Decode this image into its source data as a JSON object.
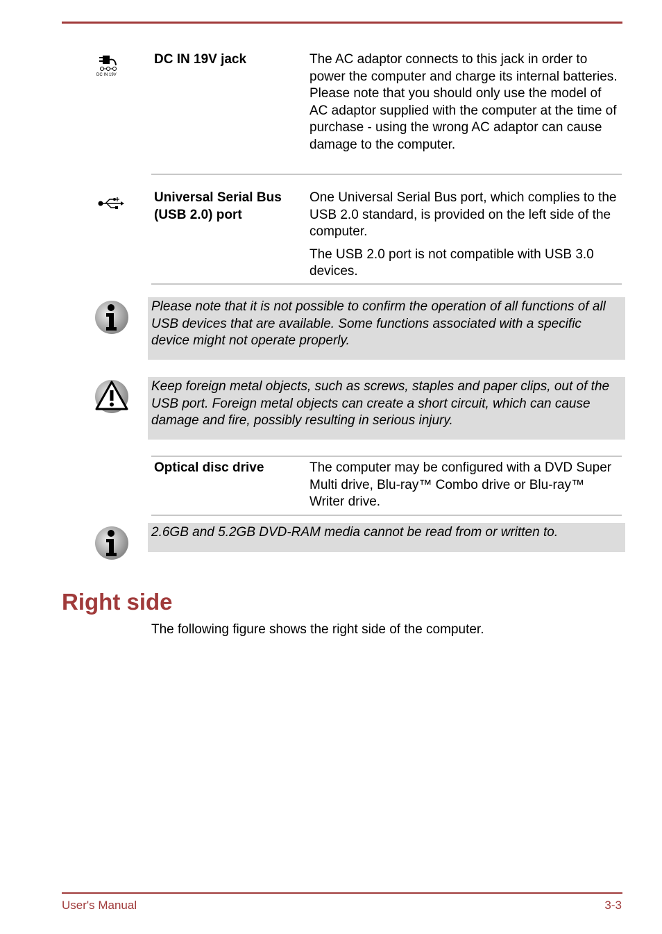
{
  "rows": [
    {
      "icon": "dc-in-jack-icon",
      "icon_caption": "DC IN 19V",
      "term": "DC IN 19V jack",
      "desc": [
        "The AC adaptor connects to this jack in order to power the computer and charge its internal batteries. Please note that you should only use the model of AC adaptor supplied with the computer at the time of purchase - using the wrong AC adaptor can cause damage to the computer."
      ]
    },
    {
      "icon": "usb-icon",
      "term": "Universal Serial Bus (USB 2.0) port",
      "desc": [
        "One Universal Serial Bus port, which complies to the USB 2.0 standard, is provided on the left side of the computer.",
        "The USB 2.0 port is not compatible with USB 3.0 devices."
      ]
    },
    {
      "term": "Optical disc drive",
      "desc": [
        "The computer may be configured with a DVD Super Multi drive, Blu-ray™ Combo drive or Blu-ray™ Writer drive."
      ]
    }
  ],
  "notes": [
    {
      "type": "info",
      "text": "Please note that it is not possible to confirm the operation of all functions of all USB devices that are available. Some functions associated with a specific device might not operate properly."
    },
    {
      "type": "warning",
      "text": "Keep foreign metal objects, such as screws, staples and paper clips, out of the USB port. Foreign metal objects can create a short circuit, which can cause damage and fire, possibly resulting in serious injury."
    },
    {
      "type": "info",
      "text": "2.6GB and 5.2GB DVD-RAM media cannot be read from or written to."
    }
  ],
  "section": {
    "heading": "Right side",
    "paragraph": "The following figure shows the right side of the computer."
  },
  "footer": {
    "left": "User's Manual",
    "right": "3-3"
  },
  "colors": {
    "accent": "#a03a3a",
    "note_bg": "#dcdcdc",
    "rule": "#c8c8c8"
  }
}
